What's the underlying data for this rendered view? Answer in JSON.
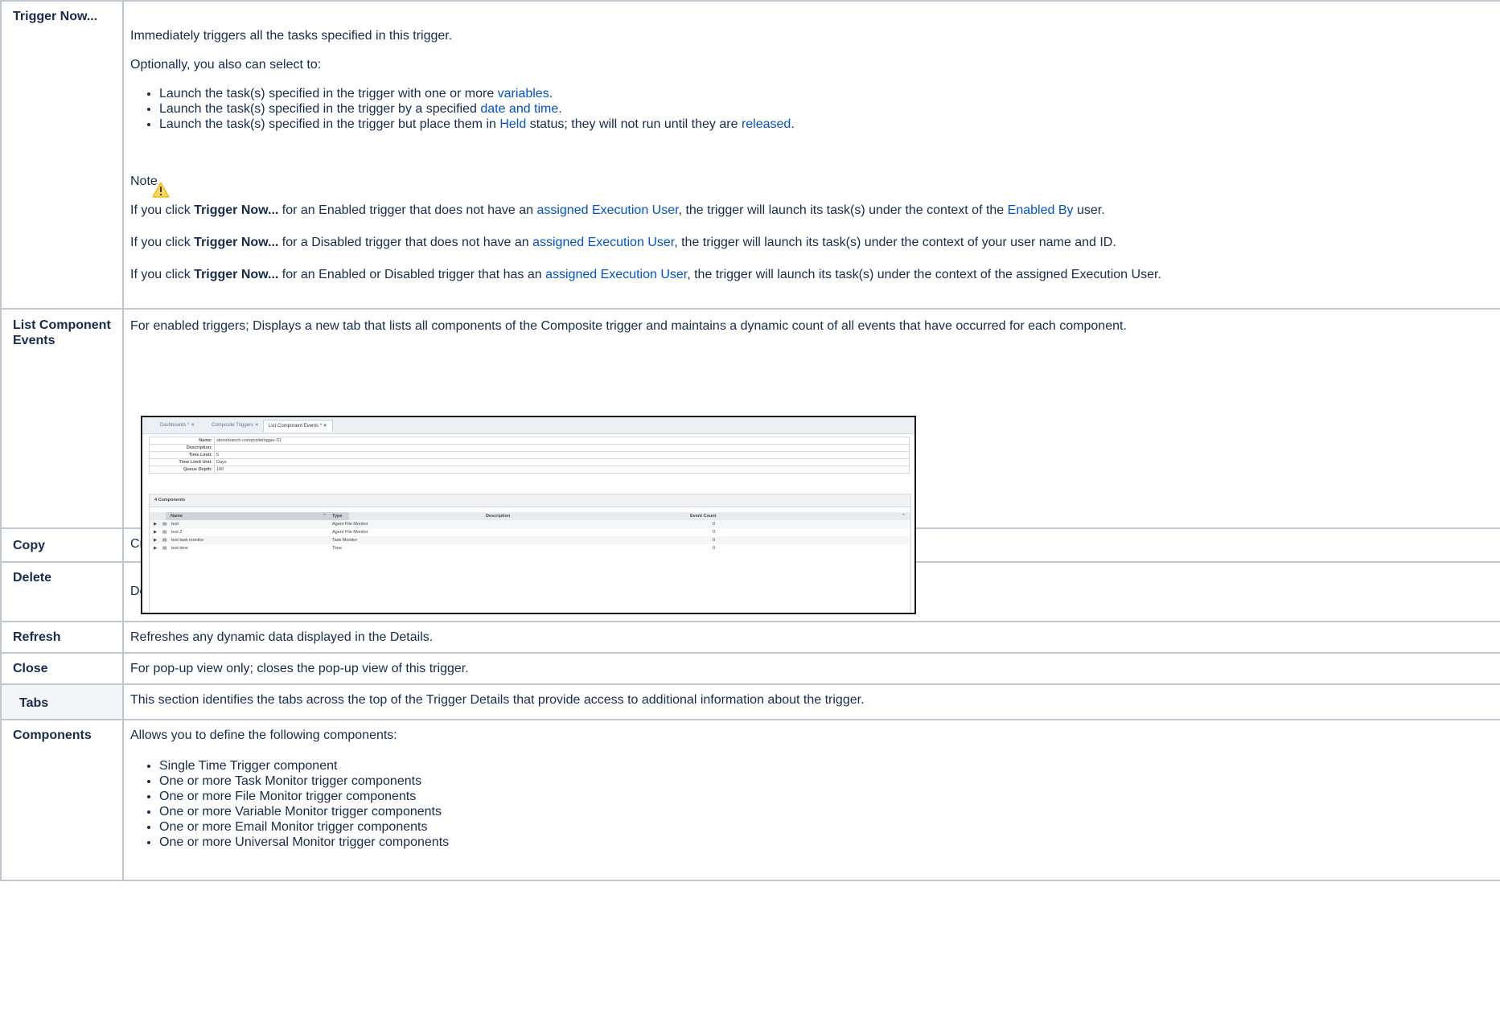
{
  "rows": {
    "trigger_now": {
      "label": "Trigger Now...",
      "intro": "Immediately triggers all the tasks specified in this trigger.",
      "optional": "Optionally, you also can select to:",
      "bullet1": {
        "pre": "Launch the task(s) specified in the trigger with one or more ",
        "link": "variables",
        "post": "."
      },
      "bullet2": {
        "pre": "Launch the task(s) specified in the trigger by a specified ",
        "link": "date and time",
        "post": "."
      },
      "bullet3": {
        "pre": "Launch the task(s) specified in the trigger but place them in ",
        "link1": "Held",
        "mid": " status; they will not run until they are ",
        "link2": "released",
        "post": "."
      },
      "note_title": "Note",
      "note1": {
        "pre": "If you click ",
        "bold": "Trigger Now...",
        "mid": " for an Enabled trigger that does not have an ",
        "link": "assigned Execution User",
        "mid2": ", the trigger will launch its task(s) under the context of the ",
        "link2": "Enabled By",
        "post": " user."
      },
      "note2": {
        "pre": "If you click ",
        "bold": "Trigger Now...",
        "mid": " for a Disabled trigger that does not have an ",
        "link": "assigned Execution User",
        "post": ", the trigger will launch its task(s) under the context of your user name and ID."
      },
      "note3": {
        "pre": "If you click ",
        "bold": "Trigger Now...",
        "mid": " for an Enabled or Disabled trigger that has an ",
        "link": "assigned Execution User",
        "post": ", the trigger will launch its task(s) under the context of the assigned Execution User."
      }
    },
    "list_component_events": {
      "label": "List Component Events",
      "desc": "For enabled triggers; Displays a new tab that lists all components of the Composite trigger and maintains a dynamic count of all events that have occurred for each component.",
      "screenshot": {
        "tabs": [
          "Dashboards",
          "Composite Triggers",
          "List Component Events"
        ],
        "fields": [
          {
            "label": "Name:",
            "value": "stonebranch-compositetrigger-01"
          },
          {
            "label": "Description:",
            "value": ""
          },
          {
            "label": "Time Limit:",
            "value": "5"
          },
          {
            "label": "Time Limit Unit:",
            "value": "Days"
          },
          {
            "label": "Queue Depth:",
            "value": "100"
          }
        ],
        "grid_title": "4 Components",
        "columns": [
          "Name",
          "Type",
          "Description",
          "Event Count"
        ],
        "rows": [
          {
            "name": "test",
            "type": "Agent File Monitor",
            "count": "0"
          },
          {
            "name": "test 2",
            "type": "Agent File Monitor",
            "count": "0"
          },
          {
            "name": "test task monitor",
            "type": "Task Monitor",
            "count": "0"
          },
          {
            "name": "test time",
            "type": "Time",
            "count": "0"
          }
        ]
      }
    },
    "copy": {
      "label": "Copy",
      "desc": "Creates a copy of this trigger, which you are prompted to rename."
    },
    "delete": {
      "label": "Delete",
      "desc": "Deletes the current record."
    },
    "refresh": {
      "label": "Refresh",
      "desc": "Refreshes any dynamic data displayed in the Details."
    },
    "close": {
      "label": "Close",
      "desc": "For pop-up view only; closes the pop-up view of this trigger."
    },
    "tabs": {
      "label": "Tabs",
      "desc": "This section identifies the tabs across the top of the Trigger Details that provide access to additional information about the trigger."
    },
    "components": {
      "label": "Components",
      "desc": "Allows you to define the following components:",
      "items": [
        "Single Time Trigger component",
        "One or more Task Monitor trigger components",
        "One or more File Monitor trigger components",
        "One or more Variable Monitor trigger components",
        "One or more Email Monitor trigger components",
        "One or more Universal Monitor trigger components"
      ]
    }
  }
}
